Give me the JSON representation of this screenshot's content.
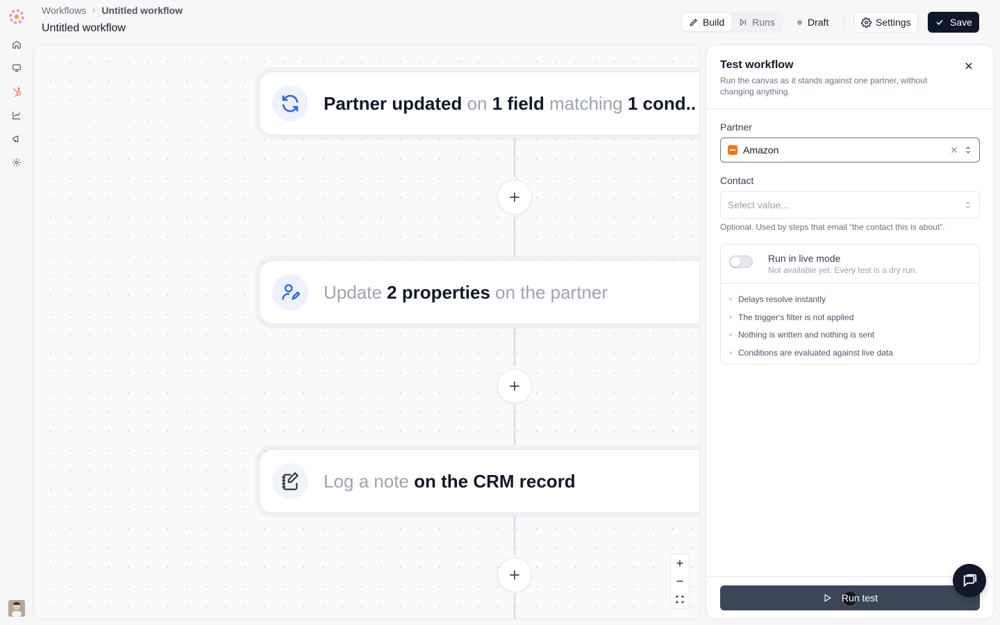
{
  "breadcrumb": {
    "root": "Workflows",
    "current": "Untitled workflow"
  },
  "page_title": "Untitled workflow",
  "toolbar": {
    "build_label": "Build",
    "runs_label": "Runs",
    "status_label": "Draft",
    "settings_label": "Settings",
    "save_label": "Save"
  },
  "nav_icons": [
    "home-icon",
    "monitor-icon",
    "hubspot-icon",
    "chart-icon",
    "megaphone-icon",
    "settings-icon"
  ],
  "colors": {
    "accent": "#0f172a",
    "hubspot": "#ff7a59",
    "trigger_icon": "#2563eb",
    "partner_chip": "#f97316"
  },
  "canvas": {
    "trigger": {
      "icon": "refresh-icon",
      "p1": "Partner updated",
      "p2": " on ",
      "p3": "1 field",
      "p4": " matching ",
      "p5": "1 cond.."
    },
    "action1": {
      "icon": "user-edit-icon",
      "p1": "Update ",
      "p2": "2 properties",
      "p3": " on the partner"
    },
    "action2": {
      "icon": "notebook-pen-icon",
      "p1": "Log a note ",
      "p2": "on the CRM record"
    }
  },
  "panel": {
    "title": "Test workflow",
    "subtitle": "Run the canvas as it stands against one partner, without changing anything.",
    "partner_label": "Partner",
    "partner_value": "Amazon",
    "contact_label": "Contact",
    "contact_placeholder": "Select value...",
    "contact_hint": "Optional. Used by steps that email “the contact this is about”.",
    "live_mode_label": "Run in live mode",
    "live_mode_sub": "Not available yet. Every test is a dry run.",
    "notes": [
      "Delays resolve instantly",
      "The trigger's filter is not applied",
      "Nothing is written and nothing is sent",
      "Conditions are evaluated against live data"
    ],
    "run_label": "Run test"
  }
}
